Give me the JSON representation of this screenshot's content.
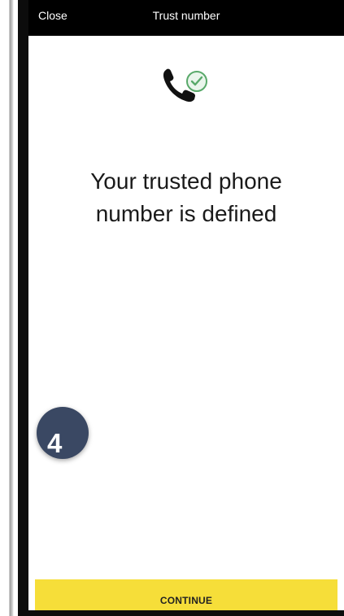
{
  "header": {
    "close_label": "Close",
    "title": "Trust number"
  },
  "main": {
    "hero_icon": "phone-check-icon",
    "headline_line1": "Your trusted phone",
    "headline_line2": "number is defined"
  },
  "step_badge": {
    "number": "4"
  },
  "footer": {
    "continue_label": "CONTINUE"
  },
  "colors": {
    "topbar": "#000000",
    "accent_yellow": "#f6de39",
    "badge": "#3a4863",
    "check_green": "#59a96a"
  }
}
